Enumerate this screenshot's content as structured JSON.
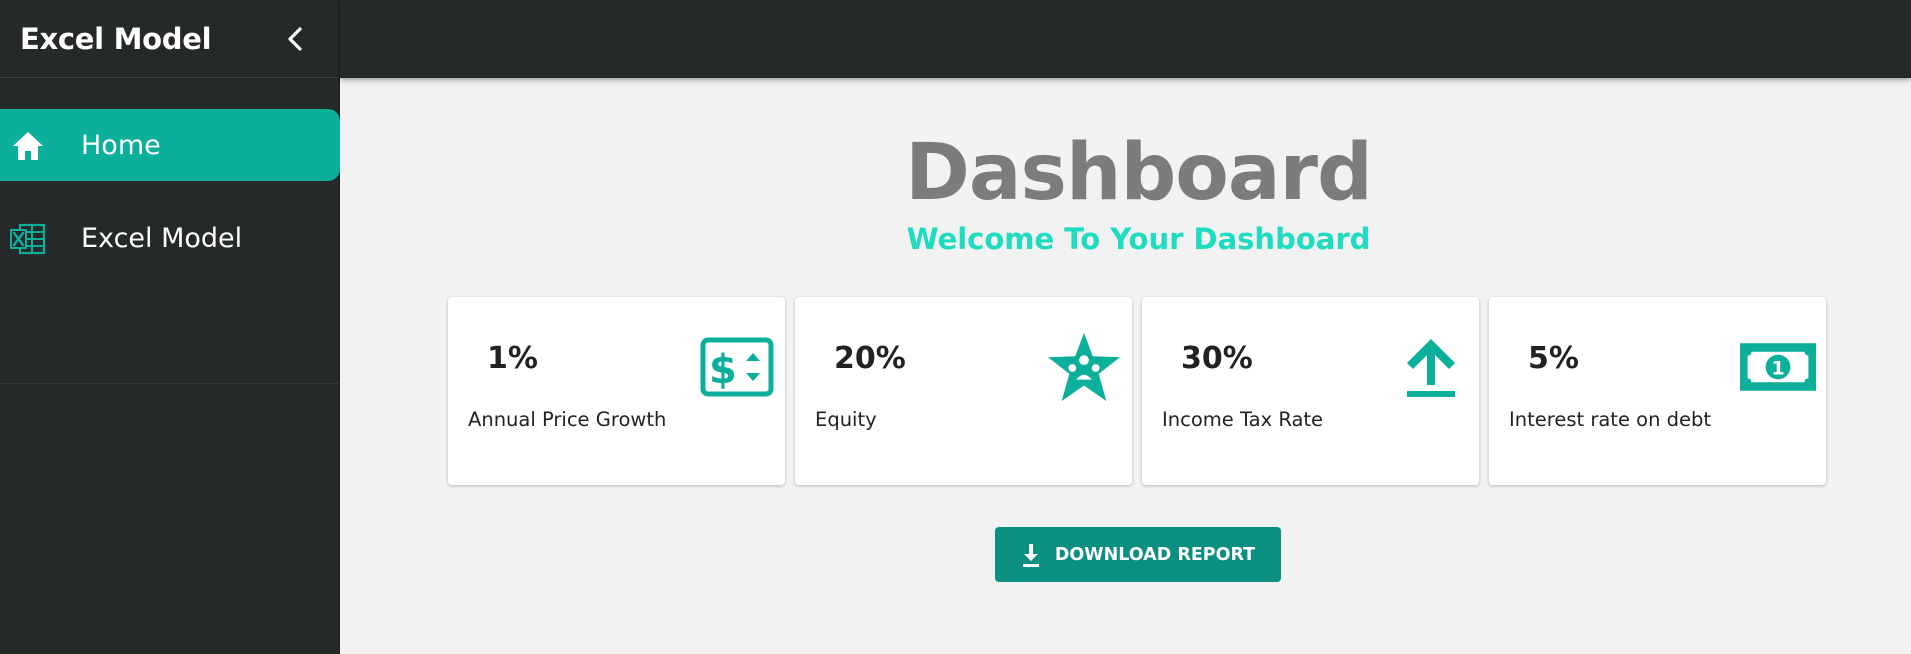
{
  "sidebar": {
    "app_title": "Excel Model",
    "items": [
      {
        "label": "Home",
        "icon": "home-icon",
        "active": true
      },
      {
        "label": "Excel Model",
        "icon": "excel-icon",
        "active": false
      }
    ]
  },
  "main": {
    "title": "Dashboard",
    "subtitle": "Welcome To Your Dashboard",
    "cards": [
      {
        "value": "1%",
        "label": "Annual Price Growth",
        "icon": "price-icon"
      },
      {
        "value": "20%",
        "label": "Equity",
        "icon": "star-group-icon"
      },
      {
        "value": "30%",
        "label": "Income Tax Rate",
        "icon": "upload-icon"
      },
      {
        "value": "5%",
        "label": "Interest rate on debt",
        "icon": "banknote-icon"
      }
    ],
    "download_label": "DOWNLOAD REPORT"
  },
  "colors": {
    "accent": "#0caf9a",
    "subtitle": "#1edcc0",
    "sidebar_bg": "#25292a",
    "button": "#0b8f80"
  }
}
